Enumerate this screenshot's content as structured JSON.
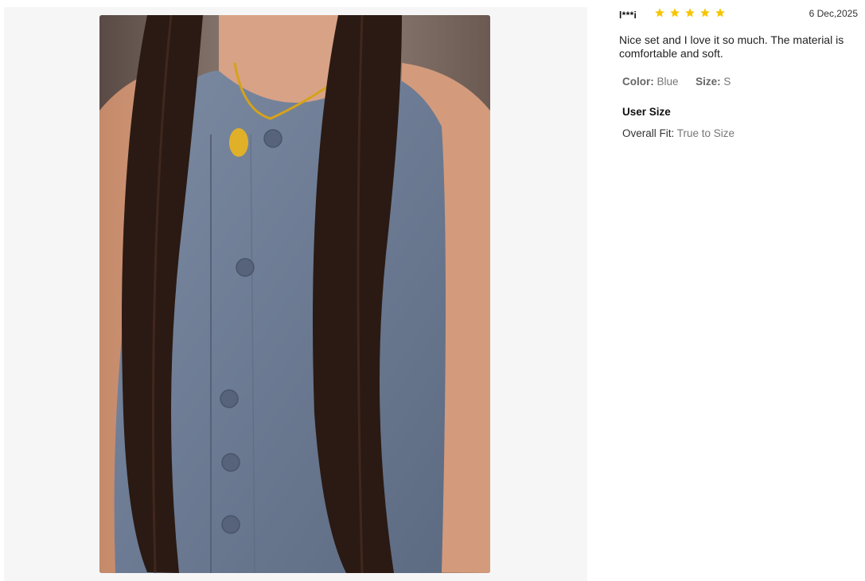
{
  "gallery": {
    "photo_alt": "Customer photo of blue sleeveless button-front linen top"
  },
  "review": {
    "user": "l***i",
    "rating": 5,
    "rating_max": 5,
    "star_color": "#f7c500",
    "date": "6 Dec,2025",
    "comment": "Nice set and I love it so much. The material is comfortable and soft.",
    "color_label": "Color:",
    "color_value": "Blue",
    "size_label": "Size:",
    "size_value": "S",
    "user_size_title": "User Size",
    "fit_label": "Overall Fit:",
    "fit_value": "True to Size"
  },
  "colors": {
    "panel_bg": "#f6f6f6",
    "fabric": "#6e7d95",
    "hair": "#2a1a13"
  }
}
